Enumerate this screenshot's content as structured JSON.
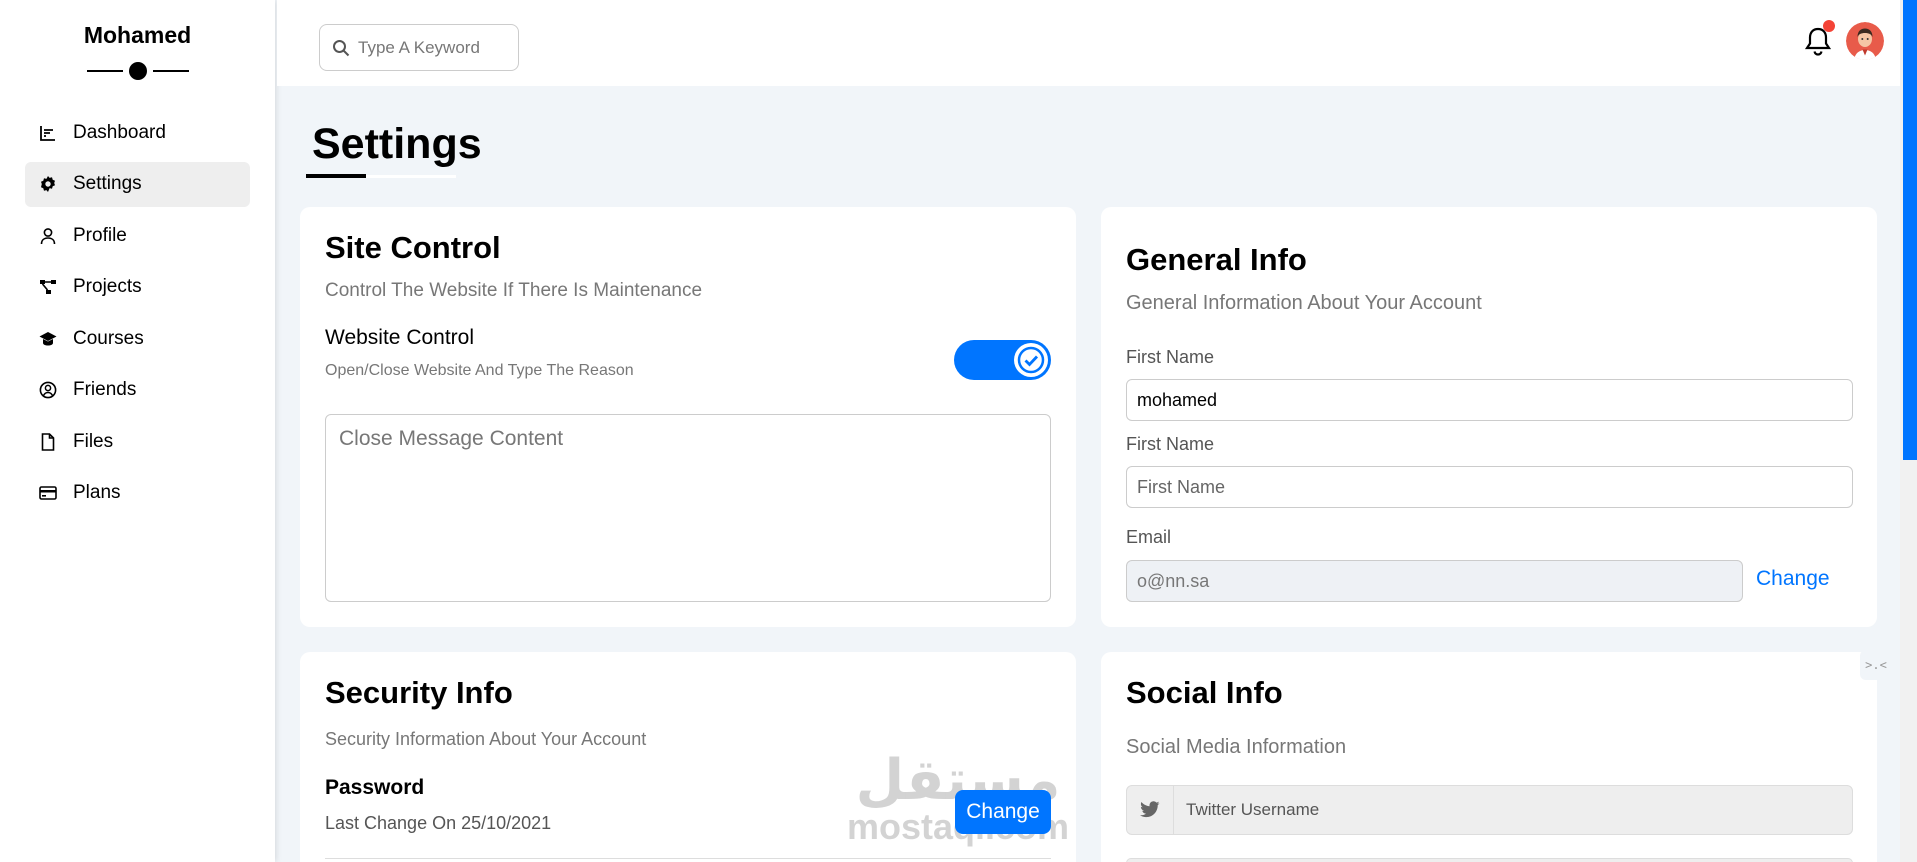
{
  "sidebar": {
    "brand": "Mohamed",
    "items": [
      {
        "label": "Dashboard",
        "icon": "chart-line-icon",
        "active": false
      },
      {
        "label": "Settings",
        "icon": "gear-icon",
        "active": true
      },
      {
        "label": "Profile",
        "icon": "user-icon",
        "active": false
      },
      {
        "label": "Projects",
        "icon": "diagram-project-icon",
        "active": false
      },
      {
        "label": "Courses",
        "icon": "graduation-cap-icon",
        "active": false
      },
      {
        "label": "Friends",
        "icon": "circle-user-icon",
        "active": false
      },
      {
        "label": "Files",
        "icon": "file-icon",
        "active": false
      },
      {
        "label": "Plans",
        "icon": "credit-card-icon",
        "active": false
      }
    ]
  },
  "header": {
    "search_placeholder": "Type A Keyword",
    "has_notification": true
  },
  "page": {
    "title": "Settings"
  },
  "site_control": {
    "title": "Site Control",
    "subtitle": "Control The Website If There Is Maintenance",
    "toggle_label": "Website Control",
    "toggle_desc": "Open/Close Website And Type The Reason",
    "toggle_on": true,
    "message_placeholder": "Close Message Content"
  },
  "general_info": {
    "title": "General Info",
    "subtitle": "General Information About Your Account",
    "first_name_label": "First Name",
    "first_name_value": "mohamed",
    "second_label": "First Name",
    "second_placeholder": "First Name",
    "email_label": "Email",
    "email_value": "o@nn.sa",
    "change_label": "Change"
  },
  "security_info": {
    "title": "Security Info",
    "subtitle": "Security Information About Your Account",
    "password_label": "Password",
    "password_desc": "Last Change On 25/10/2021",
    "change_label": "Change"
  },
  "social_info": {
    "title": "Social Info",
    "subtitle": "Social Media Information",
    "twitter_placeholder": "Twitter Username"
  },
  "watermark": {
    "arabic": "مستقل",
    "latin": "mostaql.com"
  },
  "colors": {
    "primary": "#0075ff",
    "notification": "#f44336",
    "background": "#f1f5f9"
  }
}
